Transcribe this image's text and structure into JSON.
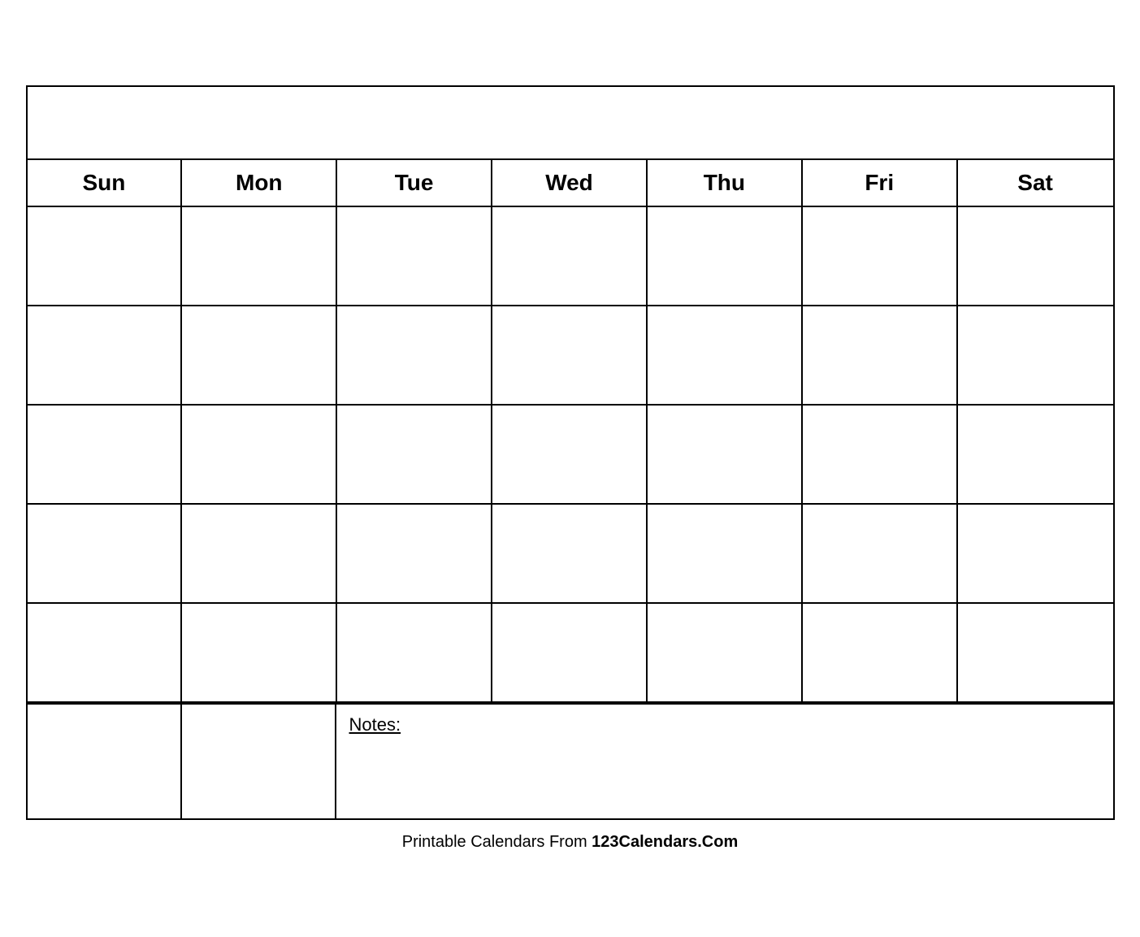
{
  "calendar": {
    "title": "",
    "days": [
      "Sun",
      "Mon",
      "Tue",
      "Wed",
      "Thu",
      "Fri",
      "Sat"
    ],
    "rows": 5,
    "notes_label": "Notes:"
  },
  "footer": {
    "text_normal": "Printable Calendars From ",
    "text_bold": "123Calendars.Com"
  }
}
